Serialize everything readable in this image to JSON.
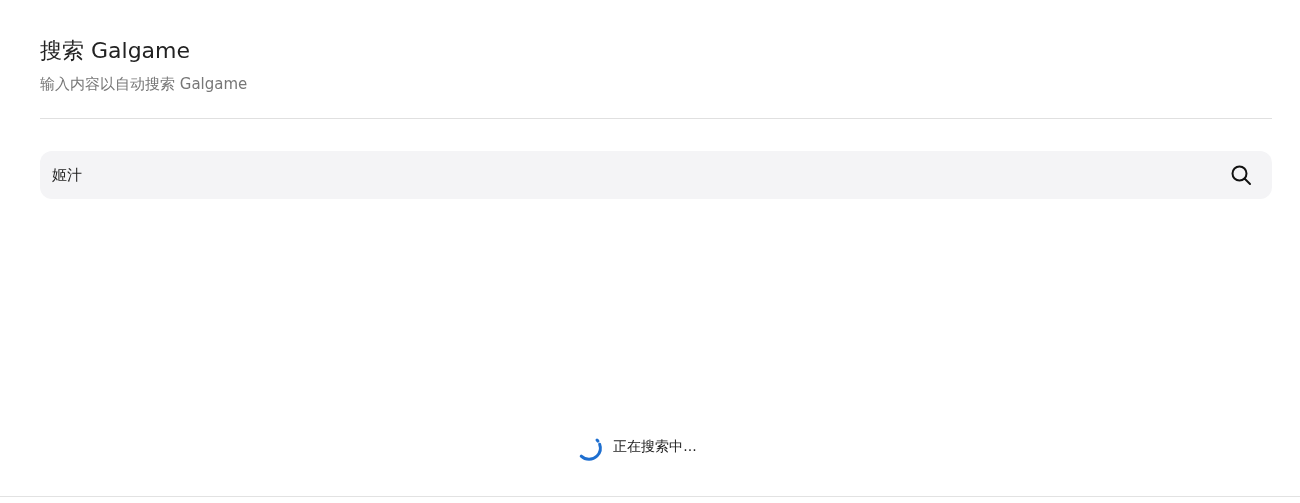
{
  "header": {
    "title": "搜索 Galgame",
    "subtitle": "输入内容以自动搜索 Galgame"
  },
  "search": {
    "value": "姬汁"
  },
  "status": {
    "text": "正在搜索中..."
  }
}
